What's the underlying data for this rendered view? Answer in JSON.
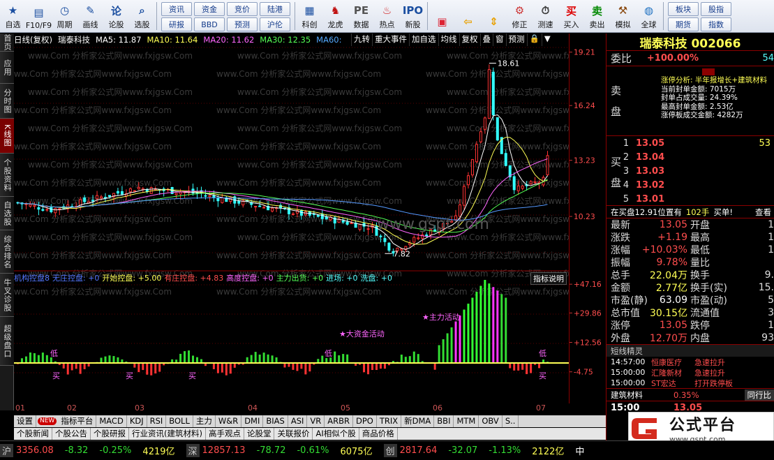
{
  "toolbar": {
    "buttons": [
      {
        "label": "自选",
        "icon": "star-icon",
        "glyph": "★"
      },
      {
        "label": "F10/F9",
        "icon": "f10-icon",
        "glyph": "▤"
      },
      {
        "label": "周期",
        "icon": "clock-icon",
        "glyph": "◷"
      },
      {
        "label": "画线",
        "icon": "pencil-icon",
        "glyph": "✎"
      },
      {
        "label": "论股",
        "icon": "discuss-icon",
        "glyph": "论"
      },
      {
        "label": "选股",
        "icon": "magnifier-icon",
        "glyph": "⌕"
      }
    ],
    "grid": [
      "资讯",
      "资金",
      "竞价",
      "陆港",
      "研报",
      "BBD",
      "预测",
      "沪伦"
    ],
    "buttons2": [
      {
        "label": "科创",
        "icon": "chart-board-icon",
        "glyph": "▦"
      },
      {
        "label": "龙虎",
        "icon": "dragon-tiger-icon",
        "glyph": "♞"
      },
      {
        "label": "数据",
        "icon": "pe-icon",
        "glyph": "PE"
      },
      {
        "label": "热点",
        "icon": "hot-icon",
        "glyph": "♨"
      },
      {
        "label": "新股",
        "icon": "ipo-icon",
        "glyph": "IPO"
      }
    ],
    "buttons3": [
      {
        "label": "",
        "icon": "window-layout-icon",
        "glyph": "▣"
      },
      {
        "label": "",
        "icon": "back-arrow-icon",
        "glyph": "⇦"
      },
      {
        "label": "",
        "icon": "up-down-icon",
        "glyph": "⇕"
      },
      {
        "label": "修正",
        "icon": "settings-icon",
        "glyph": "⚙"
      },
      {
        "label": "测速",
        "icon": "speed-test-icon",
        "glyph": "⏱"
      },
      {
        "label": "买入",
        "icon": "buy-icon",
        "glyph": "买"
      },
      {
        "label": "卖出",
        "icon": "sell-icon",
        "glyph": "卖"
      },
      {
        "label": "模拟",
        "icon": "hammer-icon",
        "glyph": "⚒"
      },
      {
        "label": "全球",
        "icon": "globe-icon",
        "glyph": "◍"
      }
    ],
    "grid2": [
      "板块",
      "股指",
      "期货",
      "指数"
    ]
  },
  "sidebar": [
    "首页",
    "应用",
    "分时图",
    "K线图",
    "个股资料",
    "自选股",
    "综合排名",
    "牛叉诊股",
    "超级盘口"
  ],
  "chart_header": {
    "period": "日线(复权)",
    "name": "瑞泰科技",
    "ma5": "MA5: 11.87",
    "ma10": "MA10: 11.64",
    "ma20": "MA20: 11.62",
    "ma30": "MA30: 12.35",
    "ma60": "MA60:",
    "tools": [
      "九转",
      "重大事件",
      "加自选",
      "均线",
      "复权",
      "叠",
      "窗",
      "预测",
      "🔒",
      "▼"
    ]
  },
  "watermark": "www.Com 分析家公式网www.fxjgsw.Com",
  "site_watermark": "www.gspt.com",
  "price_axis": [
    "19.21",
    "16.24",
    "13.23",
    "10.23"
  ],
  "indicator_axis": [
    "+47.16",
    "+29.86",
    "+12.56",
    "-4.75"
  ],
  "annotations": {
    "high": "18.61",
    "low": "7.82",
    "big_fund": "大资金活动",
    "main_active": "主力活动",
    "buy": "买",
    "low_label": "低"
  },
  "indicator_header": {
    "name": "机构控盘8",
    "no_control": "无庄控盘: +0",
    "start": "开始控盘: +5.00",
    "with": "有庄控盘: +4.83",
    "high": "高度控盘: +0",
    "out": "主力出货: +0",
    "in": "进场: +0",
    "wash": "洗盘: +0",
    "explain": "指标说明"
  },
  "date_axis": [
    "01",
    "02",
    "03",
    "04",
    "05",
    "06",
    "07"
  ],
  "indicator_tabs": [
    "设置",
    "NEW",
    "指标平台",
    "MACD",
    "KDJ",
    "RSI",
    "BOLL",
    "主力",
    "W&R",
    "DMI",
    "BIAS",
    "ASI",
    "VR",
    "ARBR",
    "DPO",
    "TRIX",
    "新DMA",
    "BBI",
    "MTM",
    "OBV",
    "S.."
  ],
  "info_tabs": [
    "个股新闻",
    "个股公告",
    "个股研报",
    "行业资讯(建筑材料)",
    "高手观点",
    "论股堂",
    "关联报价",
    "AI相似个股",
    "商品价格"
  ],
  "status": {
    "sh_label": "沪",
    "sh_value": "3356.08",
    "sh_change": "-8.32",
    "sh_pct": "-0.25%",
    "sh_amount": "4219亿",
    "sz_label": "深",
    "sz_value": "12857.13",
    "sz_change": "-78.72",
    "sz_pct": "-0.61%",
    "sz_amount": "6075亿",
    "cy_label": "创",
    "cy_value": "2817.64",
    "cy_change": "-32.07",
    "cy_pct": "-1.13%",
    "cy_amount": "2122亿",
    "extra": "中"
  },
  "panel": {
    "title": "瑞泰科技 002066",
    "weibi_label": "委比",
    "weibi_value": "+100.00%",
    "weibi_extra": "54",
    "zt_title": "涨停分析: 半年报增长+建筑材料",
    "zt_lines": [
      "当前封单金额: 7015万",
      "封单占成交量: 24.39%",
      "最高封单金额: 2.53亿",
      "涨停板成交金额: 4282万"
    ],
    "sell_label": "卖盘",
    "buy_label": "买盘",
    "bids": [
      {
        "i": "1",
        "p": "13.05",
        "q": "53"
      },
      {
        "i": "2",
        "p": "13.04",
        "q": ""
      },
      {
        "i": "3",
        "p": "13.03",
        "q": ""
      },
      {
        "i": "4",
        "p": "13.02",
        "q": ""
      },
      {
        "i": "5",
        "p": "13.01",
        "q": ""
      }
    ],
    "queue_line": "在买盘12.91位置有",
    "queue_qty": "102手",
    "queue_action": "买单!",
    "queue_view": "查看",
    "quotes": [
      {
        "k": "最新",
        "v": "13.05",
        "c": "red",
        "k2": "开盘",
        "v2": "1"
      },
      {
        "k": "涨跌",
        "v": "+1.19",
        "c": "red",
        "k2": "最高",
        "v2": "1"
      },
      {
        "k": "涨幅",
        "v": "+10.03%",
        "c": "red",
        "k2": "最低",
        "v2": "1"
      },
      {
        "k": "振幅",
        "v": "9.78%",
        "c": "red",
        "k2": "量比",
        "v2": ""
      },
      {
        "k": "总手",
        "v": "22.04万",
        "c": "yel",
        "k2": "换手",
        "v2": "9."
      },
      {
        "k": "金额",
        "v": "2.77亿",
        "c": "yel",
        "k2": "换手(实)",
        "v2": "15."
      },
      {
        "k": "市盈(静)",
        "v": "63.09",
        "c": "wht",
        "k2": "市盈(动)",
        "v2": "5"
      },
      {
        "k": "总市值",
        "v": "30.15亿",
        "c": "yel",
        "k2": "流通值",
        "v2": "3"
      },
      {
        "k": "涨停",
        "v": "13.05",
        "c": "red",
        "k2": "跌停",
        "v2": "1"
      },
      {
        "k": "外盘",
        "v": "12.70万",
        "c": "red",
        "k2": "内盘",
        "v2": "93"
      }
    ],
    "short_title": "短线精灵",
    "short_rows": [
      {
        "t": "14:57:00",
        "n": "恒康医疗",
        "e": "急速拉升"
      },
      {
        "t": "15:00:00",
        "n": "汇隆新材",
        "e": "急速拉升"
      },
      {
        "t": "15:00:00",
        "n": "ST宏达",
        "e": "打开跌停板"
      }
    ],
    "sector_name": "建筑材料",
    "sector_pct": "0.35%",
    "sector_btn": "同行比",
    "last_time": "15:00",
    "last_price": "13.05"
  },
  "logo": {
    "name": "公式平台",
    "url": "www.gspt.com"
  },
  "chart_data": {
    "type": "candlestick",
    "title": "瑞泰科技",
    "ylim": [
      7.0,
      19.5
    ],
    "x_labels": [
      "01",
      "02",
      "03",
      "04",
      "05",
      "06",
      "07"
    ],
    "annotations": {
      "high": 18.61,
      "low": 7.82
    }
  }
}
